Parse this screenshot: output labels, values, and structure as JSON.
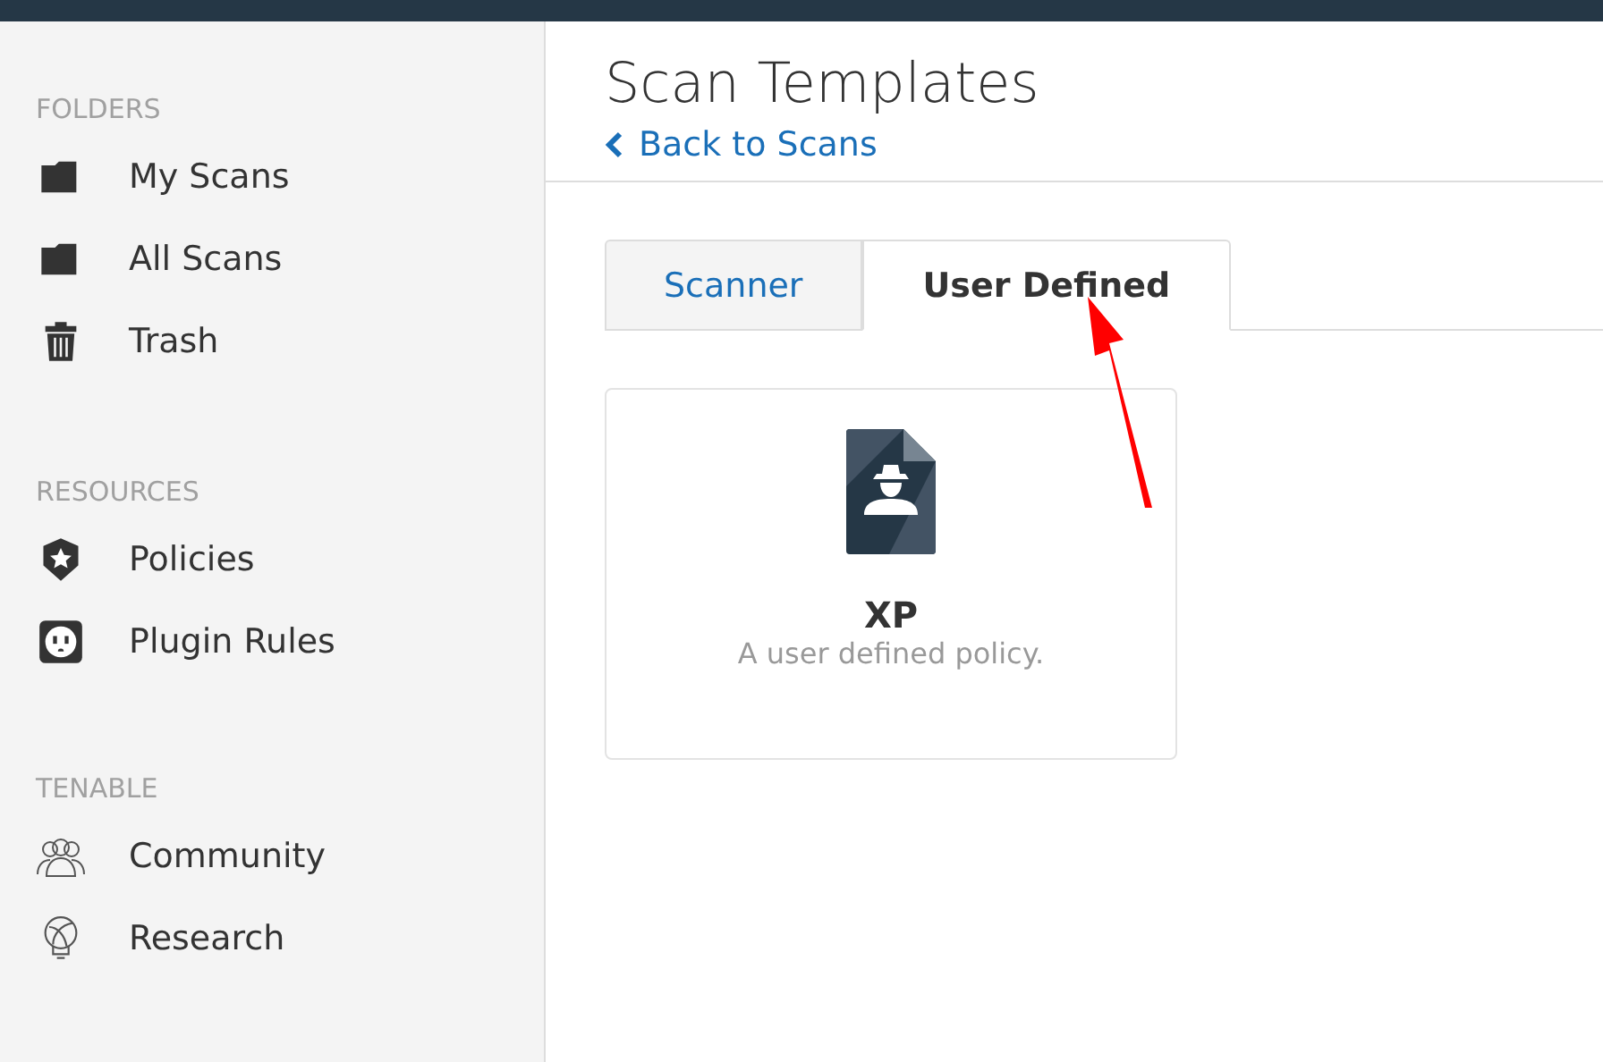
{
  "sidebar": {
    "sections": [
      {
        "heading": "FOLDERS",
        "items": [
          {
            "kind": "folder",
            "label": "My Scans"
          },
          {
            "kind": "folder",
            "label": "All Scans"
          },
          {
            "kind": "trash",
            "label": "Trash"
          }
        ]
      },
      {
        "heading": "RESOURCES",
        "items": [
          {
            "kind": "shield",
            "label": "Policies"
          },
          {
            "kind": "plug",
            "label": "Plugin Rules"
          }
        ]
      },
      {
        "heading": "TENABLE",
        "items": [
          {
            "kind": "people",
            "label": "Community"
          },
          {
            "kind": "bulb",
            "label": "Research"
          }
        ]
      }
    ]
  },
  "page": {
    "title": "Scan Templates",
    "back_link": "Back to Scans"
  },
  "tabs": [
    {
      "label": "Scanner",
      "selected": false
    },
    {
      "label": "User Defined",
      "selected": true
    }
  ],
  "templates": [
    {
      "name": "XP",
      "description": "A user defined policy."
    }
  ]
}
